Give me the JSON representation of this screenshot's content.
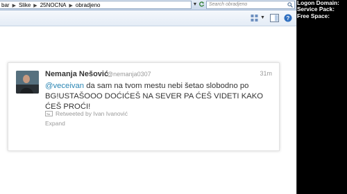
{
  "explorer": {
    "breadcrumbs": [
      "bar",
      "Slike",
      "25NOCNA",
      "obradjeno"
    ],
    "search_placeholder": "Search obradjeno"
  },
  "tweet": {
    "name": "Nemanja Nešović",
    "handle": "@nemanja0307",
    "time": "31m",
    "mention": "@veceivan",
    "body": " da sam na tvom mestu nebi šetao slobodno po BG!USTAŠOOO DOĆIĆEŠ NA SEVER PA ĆEŠ VIDETI KAKO ĆEŠ PROĆI!",
    "retweeted_by": "Retweeted by Ivan Ivanović",
    "expand": "Expand"
  },
  "system_info": {
    "logon_domain": "Logon Domain:",
    "service_pack": "Service Pack:",
    "free_space": "Free Space:"
  },
  "colors": {
    "mention": "#2a85b3",
    "muted": "#999999",
    "text": "#333333"
  }
}
